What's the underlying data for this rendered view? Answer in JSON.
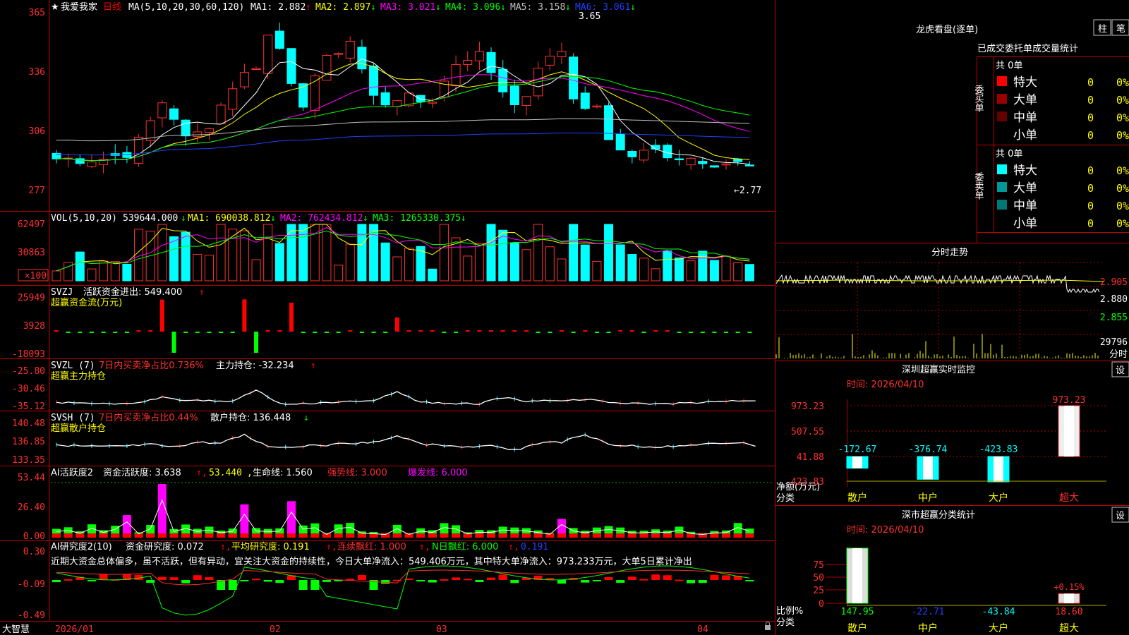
{
  "stock": {
    "name": "我爱我家",
    "period": "日线",
    "ma_params": "MA(5,10,20,30,60,120)",
    "ma_values": [
      {
        "label": "MA1:",
        "value": "2.882",
        "arrow": "↑",
        "color": "#ffffff"
      },
      {
        "label": "MA2:",
        "value": "2.897",
        "arrow": "↓",
        "color": "#ffff00"
      },
      {
        "label": "MA3:",
        "value": "3.021",
        "arrow": "↓",
        "color": "#ff00ff"
      },
      {
        "label": "MA4:",
        "value": "3.096",
        "arrow": "↓",
        "color": "#00ff00"
      },
      {
        "label": "MA5:",
        "value": "3.158",
        "arrow": "↓",
        "color": "#c0c0c0"
      },
      {
        "label": "MA6:",
        "value": "3.061",
        "arrow": "↓",
        "color": "#2040ff"
      }
    ],
    "price_axis": [
      "365",
      "336",
      "306",
      "277"
    ],
    "high_label": "3.65",
    "low_label": "←2.77",
    "star": "★"
  },
  "volume": {
    "header": "VOL(5,10,20)",
    "value": "539644.000",
    "arrow": "↓",
    "mas": [
      {
        "label": "MA1:",
        "value": "690038.812",
        "arrow": "↓",
        "color": "#ffff00"
      },
      {
        "label": "MA2:",
        "value": "762434.812",
        "arrow": "↓",
        "color": "#ff00ff"
      },
      {
        "label": "MA3:",
        "value": "1265330.375",
        "arrow": "↓",
        "color": "#00ff00"
      }
    ],
    "axis": [
      "62497",
      "30863"
    ],
    "multiplier": "×100"
  },
  "svzj": {
    "header": "SVZJ",
    "line1": "活跃资金进出: 549.400",
    "arrow": "↑",
    "line2": "超赢资金流(万元)",
    "axis": [
      "25949",
      "3928",
      "-18093"
    ]
  },
  "svzl": {
    "header": "SVZL (7)",
    "line1": "7日内买卖净占比0.736%",
    "line1b": "主力持仓: -32.234",
    "arrow": "↑",
    "line2": "超赢主力持仓",
    "axis": [
      "-25.80",
      "-30.46",
      "-35.12"
    ]
  },
  "svsh": {
    "header": "SVSH (7)",
    "line1": "7日内买卖净占比0.44%",
    "line1b": "散户持仓: 136.448",
    "arrow": "↓",
    "line2": "超赢散户持仓",
    "axis": [
      "140.48",
      "136.85",
      "133.35"
    ]
  },
  "ai_active": {
    "header": "AI活跃度2",
    "v1": "资金活跃度: 3.638",
    "v2": "53.440",
    "v3": "生命线: 1.560",
    "v4": "强势线: 3.000",
    "v5": "爆发线: 6.000",
    "axis": [
      "53.44",
      "26.40",
      "0.00"
    ]
  },
  "ai_research": {
    "header": "AI研究度2(10)",
    "v1": "资金研究度: 0.072",
    "v2": "平均研究度: 0.191",
    "v3": "连续飘红: 1.000",
    "v4": "N日飘红: 6.000",
    "v5": "0.191",
    "comment": "近期大资金总体偏多，虽不活跃，但有异动，宜关注大资金的持续性，今日大单净流入：549.406万元，其中特大单净流入：973.233万元，大单5日累计净出",
    "axis": [
      "0.30",
      "-0.09",
      "-0.49"
    ]
  },
  "dates": [
    "2026/01",
    "02",
    "03",
    "04"
  ],
  "logo": "大智慧",
  "right": {
    "title": "龙虎看盘(逐单)",
    "btn_bar": "柱",
    "btn_pen": "笔",
    "stats_title": "已成交委托单成交量统计",
    "buy_label": "委买单",
    "sell_label": "委卖单",
    "buy_total": "共 0单",
    "sell_total": "共 0单",
    "buy_rows": [
      {
        "name": "特大",
        "count": "0",
        "pct": "0%",
        "color": "#ff0000"
      },
      {
        "name": "大单",
        "count": "0",
        "pct": "0%",
        "color": "#990000"
      },
      {
        "name": "中单",
        "count": "0",
        "pct": "0%",
        "color": "#660000"
      },
      {
        "name": "小单",
        "count": "0",
        "pct": "0%",
        "color": ""
      }
    ],
    "sell_rows": [
      {
        "name": "特大",
        "count": "0",
        "pct": "0%",
        "color": "#00ffff"
      },
      {
        "name": "大单",
        "count": "0",
        "pct": "0%",
        "color": "#009999"
      },
      {
        "name": "中单",
        "count": "0",
        "pct": "0%",
        "color": "#007777"
      },
      {
        "name": "小单",
        "count": "0",
        "pct": "0%",
        "color": ""
      }
    ],
    "intraday_title": "分时走势",
    "intraday_axis": [
      "2.905",
      "2.880",
      "2.855",
      "29796"
    ],
    "intraday_unit": "分时",
    "monitor_title": "深圳超赢实时监控",
    "monitor_btn": "设",
    "monitor_time": "时间: 2026/04/10",
    "monitor_axis": [
      "973.23",
      "507.55",
      "41.88",
      "-423.83"
    ],
    "monitor_unit1": "净额(万元)",
    "monitor_unit2": "分类",
    "monitor_bars": [
      {
        "name": "散户",
        "value": -172.67,
        "label": "-172.67"
      },
      {
        "name": "中户",
        "value": -376.74,
        "label": "-376.74"
      },
      {
        "name": "大户",
        "value": -423.83,
        "label": "-423.83"
      },
      {
        "name": "超大",
        "value": 973.23,
        "label": "973.23"
      }
    ],
    "cat_title": "深市超赢分类统计",
    "cat_btn": "设",
    "cat_time": "时间: 2026/04/10",
    "cat_axis": [
      "75",
      "50",
      "25",
      "0"
    ],
    "cat_unit1": "比例%",
    "cat_unit2": "分类",
    "cat_extra": "+0.15%",
    "cat_bars": [
      {
        "name": "散户",
        "value": 147.95,
        "label": "147.95"
      },
      {
        "name": "中户",
        "value": -22.71,
        "label": "-22.71"
      },
      {
        "name": "大户",
        "value": -43.84,
        "label": "-43.84"
      },
      {
        "name": "超大",
        "value": 18.6,
        "label": "18.60"
      }
    ]
  }
}
